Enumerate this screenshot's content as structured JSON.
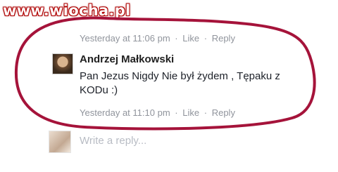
{
  "watermark": {
    "text": "www.wiocha.pl"
  },
  "previous_comment": {
    "timestamp": "Yesterday at 11:06 pm",
    "like_label": "Like",
    "reply_label": "Reply",
    "separator": "·"
  },
  "comment": {
    "author": "Andrzej Małkowski",
    "text": "Pan Jezus Nigdy Nie był żydem , Tępaku z KODu :)",
    "timestamp": "Yesterday at 11:10 pm",
    "like_label": "Like",
    "reply_label": "Reply",
    "separator": "·"
  },
  "reply_box": {
    "placeholder": "Write a reply..."
  },
  "colors": {
    "annotation_ring": "#a5133a",
    "watermark_outline": "#b00000",
    "meta_text": "#90949c"
  }
}
